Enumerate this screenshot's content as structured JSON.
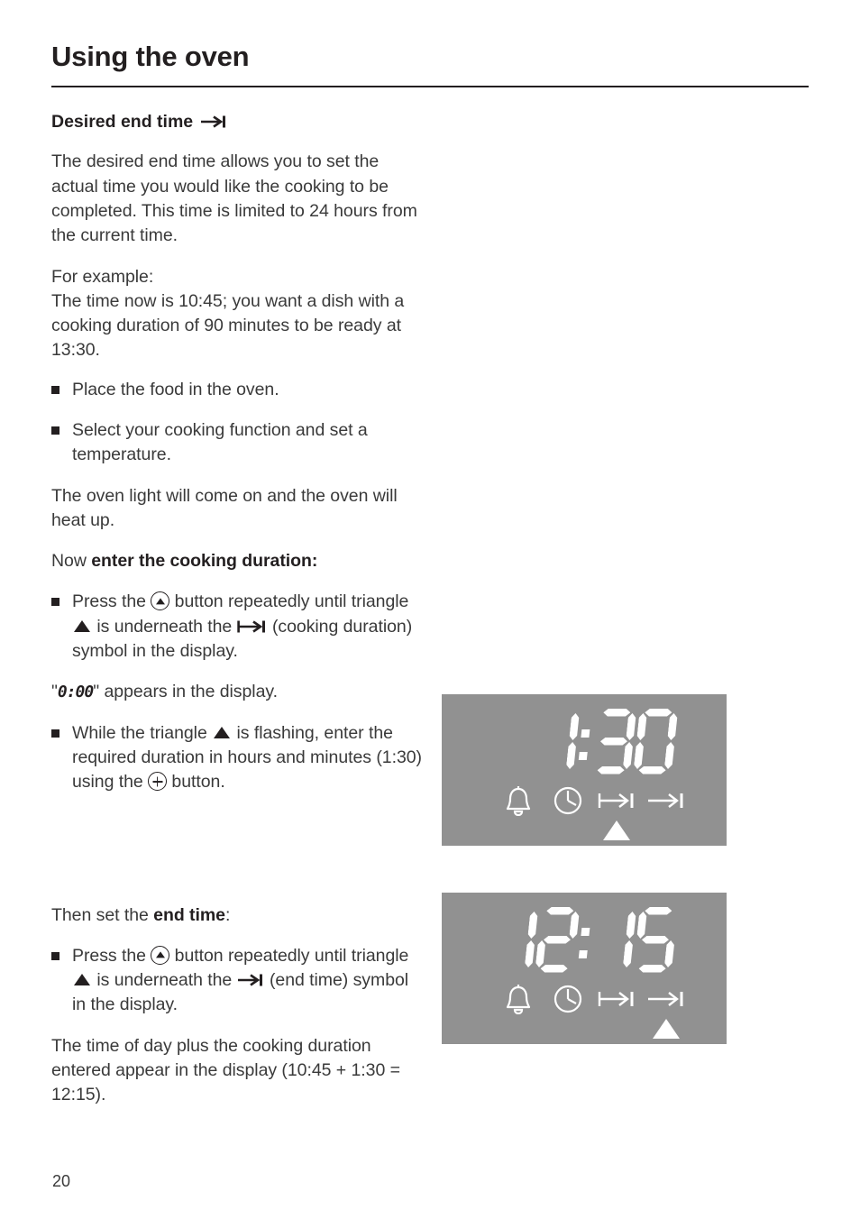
{
  "document": {
    "chapter_title": "Using the oven",
    "page_number": "20"
  },
  "section": {
    "heading": "Desired end time",
    "heading_symbol": "end-time-arrow-bar-icon"
  },
  "paragraphs": {
    "intro": "The desired end time allows you to set the actual time you would like the cooking to be completed. This time is limited to 24 hours from the current time.",
    "example_label": "For example:",
    "example_body": "The time now is 10:45; you want a dish with a cooking duration of 90 minutes to be ready at 13:30.",
    "oven_light": "The oven light will come on and the oven will heat up.",
    "zero_display_suffix": "\" appears in the display.",
    "zero_display_value": "0:00",
    "zero_display_prefix": "\"",
    "time_of_day": "The time of day plus the cooking duration entered appear in the display (10:45 + 1:30 = 12:15)."
  },
  "bullets": {
    "place_food": "Place the food in the oven.",
    "select_function": "Select your cooking function and set a temperature.",
    "press_until_duration": {
      "part1": "Press the ",
      "part2": " button repeatedly until triangle ",
      "part3": " is underneath the ",
      "part4": " (cooking duration) symbol in the display."
    },
    "while_flashing": {
      "part1": "While the triangle ",
      "part2": " is flashing, enter the required duration in hours and minutes (1:30) using the ",
      "part3": " button."
    },
    "press_until_endtime": {
      "part1": "Press the ",
      "part2": " button repeatedly until triangle ",
      "part3": " is underneath the ",
      "part4": " (end time) symbol in the display."
    }
  },
  "subheads": {
    "now_enter_prefix": "Now ",
    "now_enter_bold": "enter the cooking duration:",
    "then_set_prefix": "Then set the ",
    "then_set_bold": "end time",
    "then_set_suffix": ":"
  },
  "displays": [
    {
      "id": "duration-display",
      "readout": "1:30",
      "icons": [
        "bell-icon",
        "clock-icon",
        "cooking-duration-icon",
        "end-time-icon"
      ],
      "pointer_index": 2,
      "pointer_label": "cooking-duration"
    },
    {
      "id": "endtime-display",
      "readout": "12:15",
      "icons": [
        "bell-icon",
        "clock-icon",
        "cooking-duration-icon",
        "end-time-icon"
      ],
      "pointer_index": 3,
      "pointer_label": "end-time"
    }
  ],
  "colors": {
    "text": "#231f20",
    "body_text": "#3a3a3a",
    "display_background": "#919191",
    "display_foreground": "#ffffff",
    "page_background": "#ffffff"
  }
}
